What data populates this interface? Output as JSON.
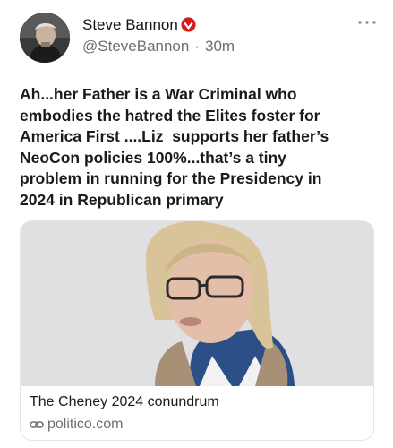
{
  "tweet": {
    "author": {
      "display_name": "Steve Bannon",
      "handle": "@SteveBannon",
      "timestamp": "30m",
      "separator": "·",
      "badge_icon": "verified-badge-icon",
      "badge_color": "#d71a1a"
    },
    "text": "Ah...her Father is a War Criminal who\nembodies the hatred the Elites foster for\nAmerica First ....Liz  supports her father’s\nNeoCon policies 100%...that’s a tiny\nproblem in running for the Presidency in\n2024 in Republican primary",
    "more_icon": "more-options-icon",
    "link_card": {
      "title": "The Cheney 2024 conundrum",
      "domain": "politico.com",
      "domain_icon": "link-icon"
    }
  },
  "colors": {
    "text": "#1a1a1a",
    "secondary": "#6b6f74",
    "border": "#e3e6e9"
  }
}
